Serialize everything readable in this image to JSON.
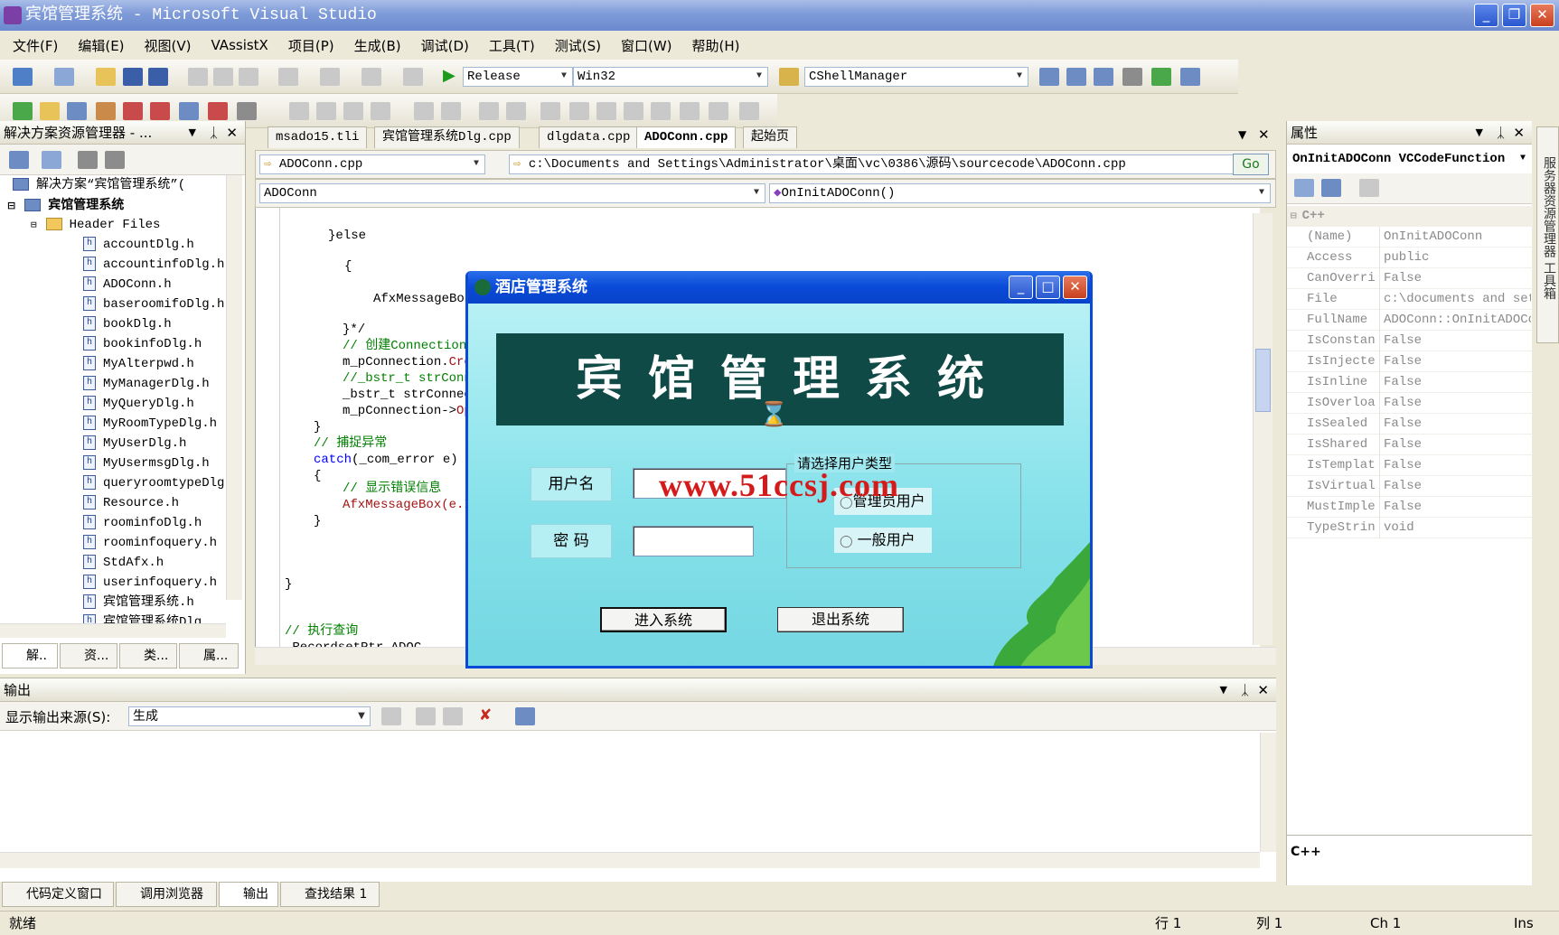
{
  "window": {
    "title": "宾馆管理系统 - Microsoft Visual Studio"
  },
  "menu": [
    "文件(F)",
    "编辑(E)",
    "视图(V)",
    "VAssistX",
    "项目(P)",
    "生成(B)",
    "调试(D)",
    "工具(T)",
    "测试(S)",
    "窗口(W)",
    "帮助(H)"
  ],
  "toolbar": {
    "config": "Release",
    "platform": "Win32",
    "class_combo": "CShellManager"
  },
  "solution_explorer": {
    "title": "解决方案资源管理器 - ...",
    "root": "解决方案“宾馆管理系统”(",
    "project": "宾馆管理系统",
    "folder": "Header Files",
    "files": [
      "accountDlg.h",
      "accountinfoDlg.h",
      "ADOConn.h",
      "baseroomifoDlg.h",
      "bookDlg.h",
      "bookinfoDlg.h",
      "MyAlterpwd.h",
      "MyManagerDlg.h",
      "MyQueryDlg.h",
      "MyRoomTypeDlg.h",
      "MyUserDlg.h",
      "MyUsermsgDlg.h",
      "queryroomtypeDlg",
      "Resource.h",
      "roominfoDlg.h",
      "roominfoquery.h",
      "StdAfx.h",
      "userinfoquery.h",
      "宾馆管理系统.h",
      "宾馆管理系统Dlg."
    ],
    "bottom_tabs": [
      "解..",
      "资...",
      "类...",
      "属..."
    ]
  },
  "editor": {
    "tabs": [
      "msado15.tli",
      "宾馆管理系统Dlg.cpp",
      "dlgdata.cpp",
      "ADOConn.cpp",
      "起始页"
    ],
    "file_combo": "ADOConn.cpp",
    "path": "c:\\Documents and Settings\\Administrator\\桌面\\vc\\0386\\源码\\sourcecode\\ADOConn.cpp",
    "go": "Go",
    "class_combo": "ADOConn",
    "method_combo": "OnInitADOConn()",
    "code": {
      "l1": "}else",
      "l2": "{",
      "l3": "AfxMessageBox",
      "l4": "}*/",
      "l5": "// 创建Connection",
      "l6a": "m_pConnection.",
      "l6b": "Cre",
      "l7": "//_bstr_t strConn",
      "l8": "_bstr_t strConnec",
      "l9a": "m_pConnection->",
      "l9b": "Op",
      "l10": "}",
      "l11": "// 捕捉异常",
      "l12a": "catch",
      "l12b": "(_com_error e)",
      "l13": "{",
      "l14": "// 显示错误信息",
      "l15": "AfxMessageBox(e.I",
      "l16": "}",
      "l17": "}",
      "l18": "// 执行查询",
      "l19": "_RecordsetPtr ADOC"
    }
  },
  "dialog": {
    "title": "酒店管理系统",
    "banner": "宾馆管理系统",
    "username_label": "用户名",
    "password_label": "密 码",
    "watermark": "www.51ccsj.com",
    "group_title": "请选择用户类型",
    "radio_admin": "管理员用户",
    "radio_user": "一般用户",
    "enter_button": "进入系统",
    "exit_button": "退出系统"
  },
  "properties": {
    "title": "属性",
    "object": "OnInitADOConn VCCodeFunction",
    "category": "C++",
    "rows": [
      {
        "name": "(Name)",
        "value": "OnInitADOConn"
      },
      {
        "name": "Access",
        "value": "public"
      },
      {
        "name": "CanOverri",
        "value": "False"
      },
      {
        "name": "File",
        "value": "c:\\documents and sett"
      },
      {
        "name": "FullName",
        "value": "ADOConn::OnInitADOCon"
      },
      {
        "name": "IsConstan",
        "value": "False"
      },
      {
        "name": "IsInjecte",
        "value": "False"
      },
      {
        "name": "IsInline",
        "value": "False"
      },
      {
        "name": "IsOverloa",
        "value": "False"
      },
      {
        "name": "IsSealed",
        "value": "False"
      },
      {
        "name": "IsShared",
        "value": "False"
      },
      {
        "name": "IsTemplat",
        "value": "False"
      },
      {
        "name": "IsVirtual",
        "value": "False"
      },
      {
        "name": "MustImple",
        "value": "False"
      },
      {
        "name": "TypeStrin",
        "value": "void"
      }
    ],
    "description": "C++",
    "side_tabs": "服务器资源管理器 工具箱"
  },
  "output": {
    "title": "输出",
    "source_label": "显示输出来源(S):",
    "source_value": "生成",
    "bottom_tabs": [
      "代码定义窗口",
      "调用浏览器",
      "输出",
      "查找结果 1"
    ]
  },
  "status": {
    "ready": "就绪",
    "line": "行 1",
    "col": "列 1",
    "ch": "Ch 1",
    "mode": "Ins"
  }
}
